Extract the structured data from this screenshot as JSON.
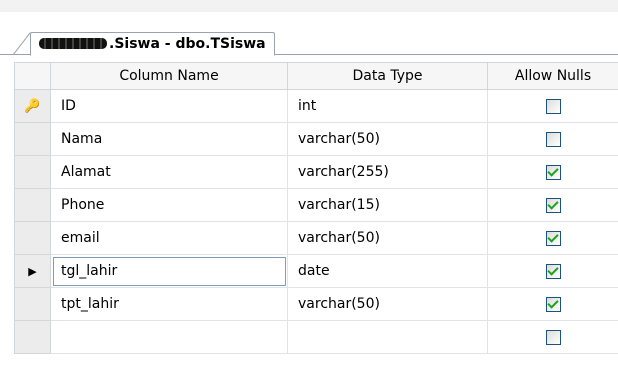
{
  "tab": {
    "title": ".Siswa - dbo.TSiswa"
  },
  "grid": {
    "headers": {
      "column_name": "Column Name",
      "data_type": "Data Type",
      "allow_nulls": "Allow Nulls"
    },
    "rows": [
      {
        "name": "ID",
        "type": "int",
        "allow_nulls": false,
        "primary_key": true
      },
      {
        "name": "Nama",
        "type": "varchar(50)",
        "allow_nulls": false
      },
      {
        "name": "Alamat",
        "type": "varchar(255)",
        "allow_nulls": true
      },
      {
        "name": "Phone",
        "type": "varchar(15)",
        "allow_nulls": true
      },
      {
        "name": "email",
        "type": "varchar(50)",
        "allow_nulls": true
      },
      {
        "name": "tgl_lahir",
        "type": "date",
        "allow_nulls": true,
        "current": true
      },
      {
        "name": "tpt_lahir",
        "type": "varchar(50)",
        "allow_nulls": true
      },
      {
        "name": "",
        "type": "",
        "allow_nulls": false
      }
    ]
  },
  "icons": {
    "primary_key": "key-icon",
    "current_row": "row-pointer-icon"
  },
  "colors": {
    "check": "#21a121",
    "checkbox_border": "#1c5180"
  }
}
